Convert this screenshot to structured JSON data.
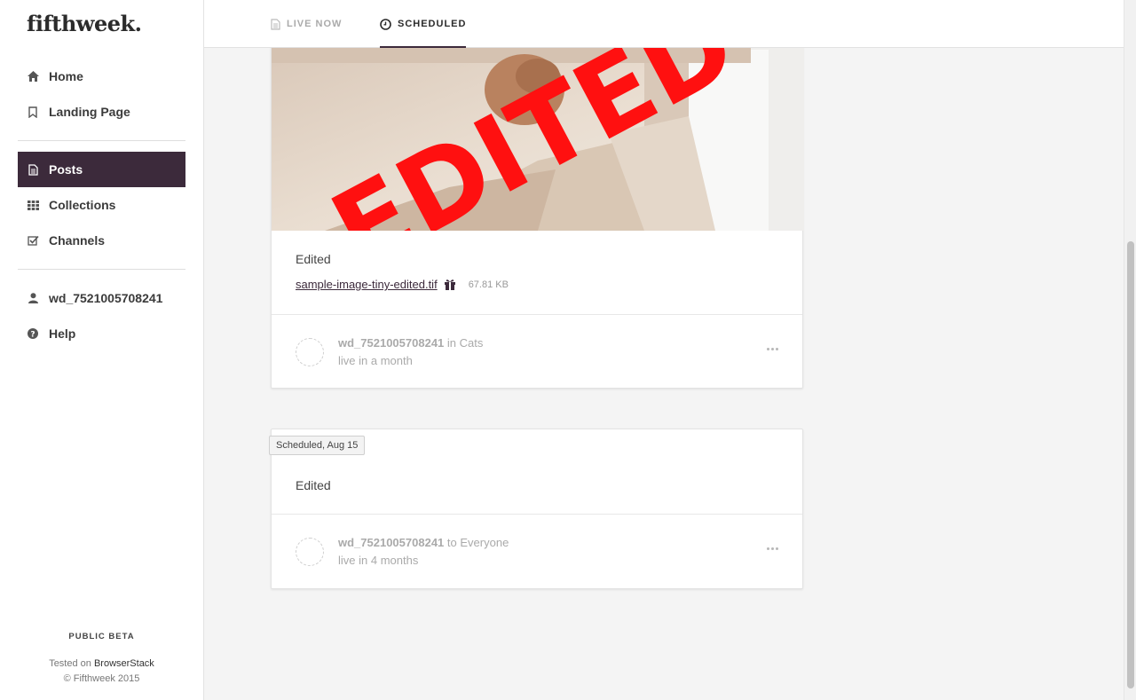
{
  "app": {
    "logo": "fifthweek."
  },
  "sidebar": {
    "items": [
      {
        "label": "Home",
        "icon": "home-icon"
      },
      {
        "label": "Landing Page",
        "icon": "bookmark-icon"
      },
      {
        "label": "Posts",
        "icon": "document-icon",
        "active": true
      },
      {
        "label": "Collections",
        "icon": "grid-icon"
      },
      {
        "label": "Channels",
        "icon": "checkbox-icon"
      },
      {
        "label": "wd_7521005708241",
        "icon": "user-icon"
      },
      {
        "label": "Help",
        "icon": "question-icon"
      }
    ],
    "footer": {
      "beta": "PUBLIC BETA",
      "tested_prefix": "Tested on",
      "tested_link": "BrowserStack",
      "copyright": "© Fifthweek 2015"
    }
  },
  "tabs": [
    {
      "label": "LIVE NOW",
      "icon": "document-icon"
    },
    {
      "label": "SCHEDULED",
      "icon": "clock-icon",
      "active": true
    }
  ],
  "posts": [
    {
      "image_watermark": "EDITED",
      "text": "Edited",
      "file_name": "sample-image-tiny-edited.tif",
      "file_size": "67.81 KB",
      "author": "wd_7521005708241",
      "connector": "in",
      "target": "Cats",
      "live": "live in a month"
    },
    {
      "badge": "Scheduled, Aug 15",
      "text": "Edited",
      "author": "wd_7521005708241",
      "connector": "to",
      "target": "Everyone",
      "live": "live in 4 months"
    }
  ],
  "colors": {
    "accent": "#3c2a3b",
    "background": "#f4f4f4"
  }
}
